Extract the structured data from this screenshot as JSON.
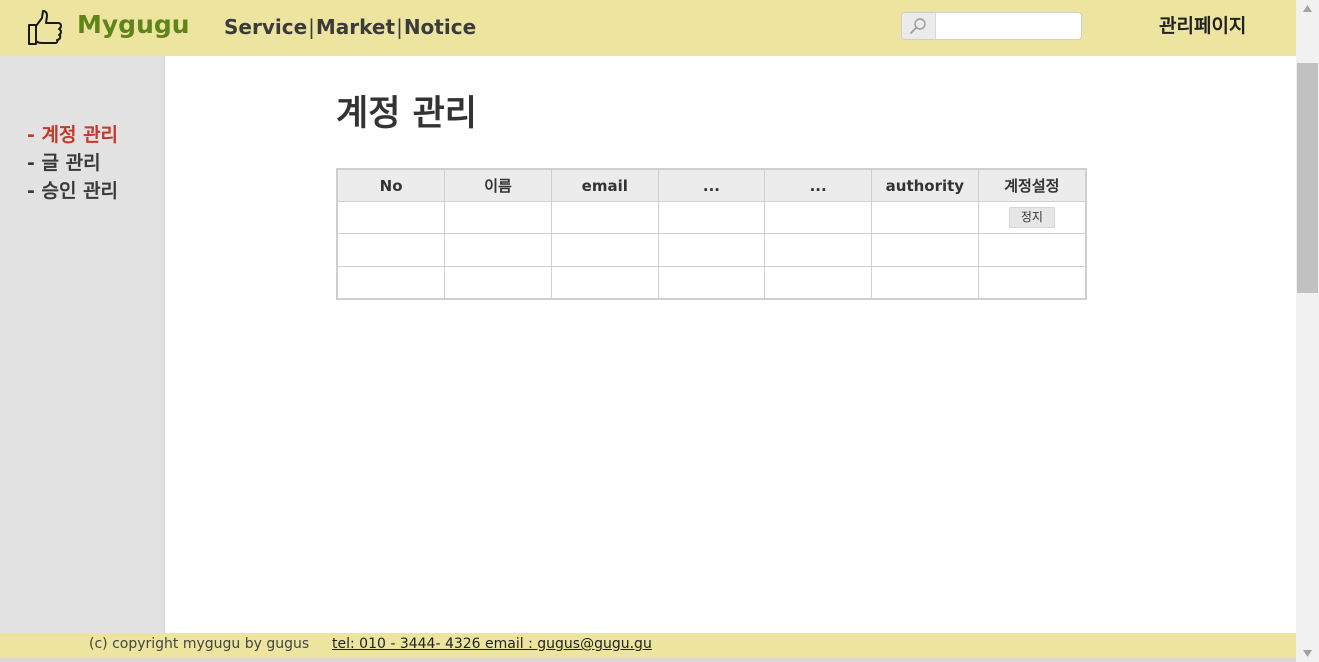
{
  "header": {
    "brand": "Mygugu",
    "nav": [
      "Service",
      "Market",
      "Notice"
    ],
    "nav_separator": "|",
    "search_placeholder": "",
    "admin_link": "관리페이지"
  },
  "sidebar": {
    "items": [
      {
        "label": "- 계정 관리",
        "active": true
      },
      {
        "label": "- 글 관리",
        "active": false
      },
      {
        "label": "- 승인 관리",
        "active": false
      }
    ]
  },
  "main": {
    "title": "계정 관리",
    "table": {
      "columns": [
        "No",
        "이름",
        "email",
        "...",
        "...",
        "authority",
        "계정설정"
      ],
      "rows": [
        [
          "",
          "",
          "",
          "",
          "",
          "",
          "정지"
        ],
        [
          "",
          "",
          "",
          "",
          "",
          "",
          ""
        ],
        [
          "",
          "",
          "",
          "",
          "",
          "",
          ""
        ]
      ]
    }
  },
  "footer": {
    "copyright": "(c) copyright mygugu by gugus",
    "contact": "tel: 010 - 3444- 4326   email : gugus@gugu.gu"
  },
  "colors": {
    "header_bg": "#ede59f",
    "brand": "#5f8418",
    "active_menu": "#c4392a",
    "sidebar_bg": "#e2e2e2"
  },
  "icons": {
    "logo": "thumbs-up-icon",
    "search": "search-icon",
    "scroll_up": "arrow-up-icon",
    "scroll_down": "arrow-down-icon"
  }
}
